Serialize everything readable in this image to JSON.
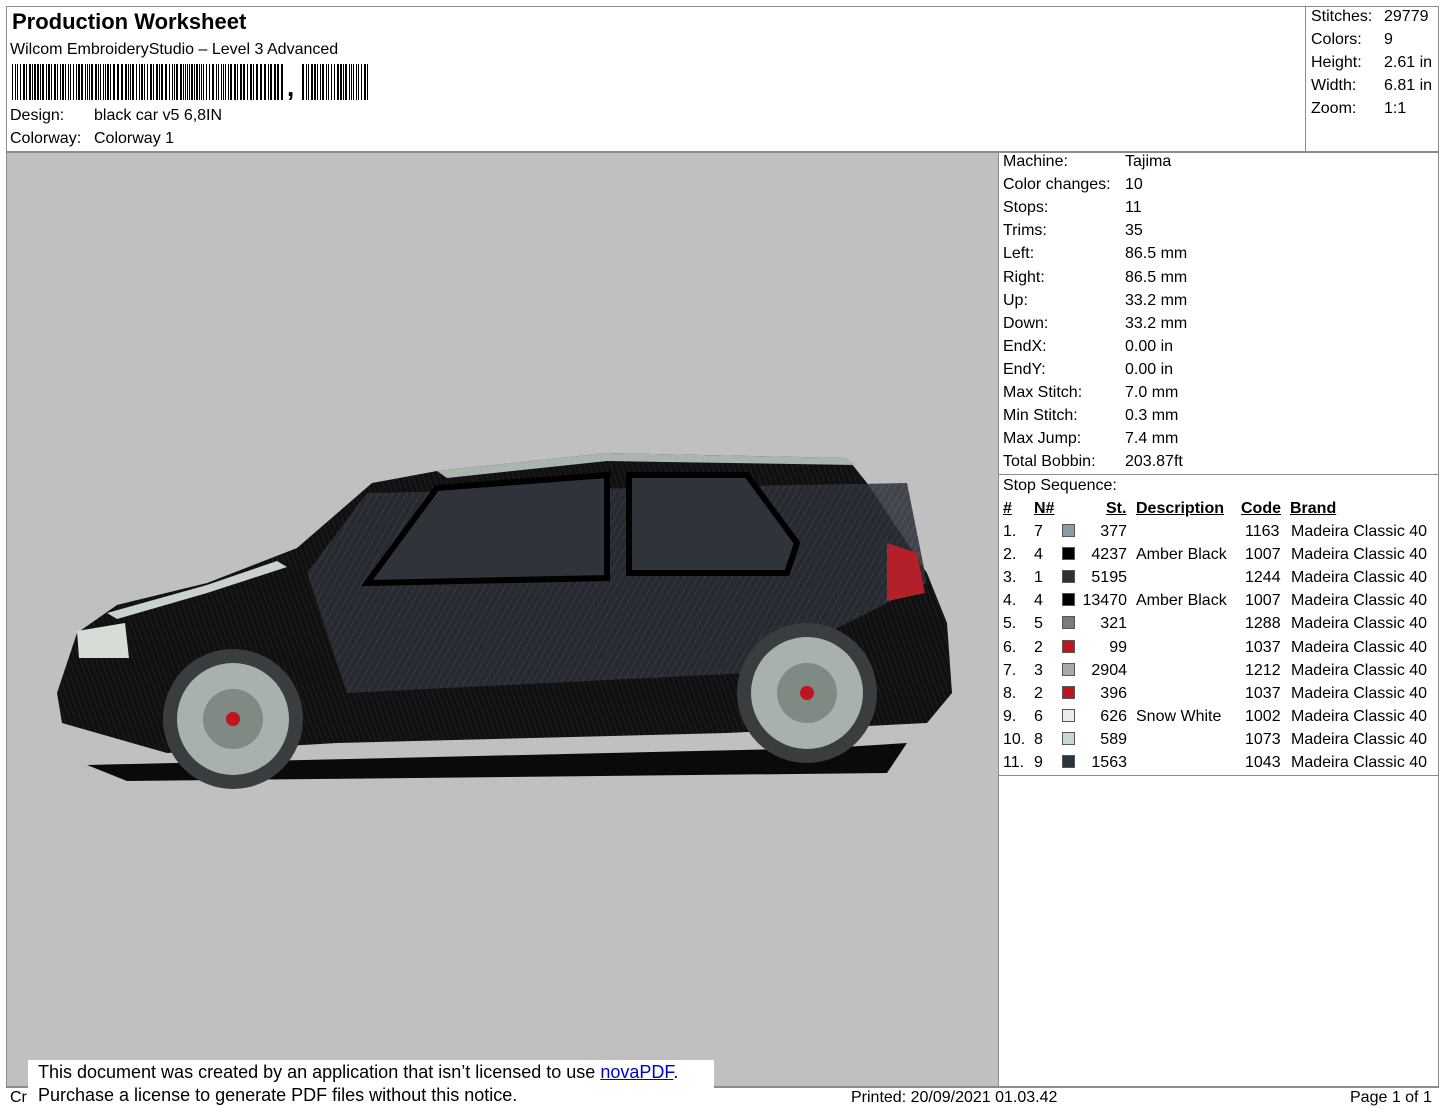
{
  "header": {
    "title": "Production Worksheet",
    "software": "Wilcom EmbroideryStudio – Level 3 Advanced",
    "barcode_suffix": ",",
    "design_label": "Design:",
    "design_value": "black car v5 6,8IN",
    "colorway_label": "Colorway:",
    "colorway_value": "Colorway 1"
  },
  "stats": [
    {
      "k": "Stitches:",
      "v": "29779"
    },
    {
      "k": "Colors:",
      "v": "9"
    },
    {
      "k": "Height:",
      "v": "2.61 in"
    },
    {
      "k": "Width:",
      "v": "6.81 in"
    },
    {
      "k": "Zoom:",
      "v": "1:1"
    }
  ],
  "machine_info": [
    {
      "k": "Machine:",
      "v": "Tajima"
    },
    {
      "k": "Color changes:",
      "v": "10"
    },
    {
      "k": "Stops:",
      "v": "11"
    },
    {
      "k": "Trims:",
      "v": "35"
    },
    {
      "k": "Left:",
      "v": "86.5 mm"
    },
    {
      "k": "Right:",
      "v": "86.5 mm"
    },
    {
      "k": "Up:",
      "v": "33.2 mm"
    },
    {
      "k": "Down:",
      "v": "33.2 mm"
    },
    {
      "k": "EndX:",
      "v": "0.00 in"
    },
    {
      "k": "EndY:",
      "v": "0.00 in"
    },
    {
      "k": "Max Stitch:",
      "v": "7.0 mm"
    },
    {
      "k": "Min Stitch:",
      "v": "0.3 mm"
    },
    {
      "k": "Max Jump:",
      "v": "7.4 mm"
    },
    {
      "k": "Total Bobbin:",
      "v": "203.87ft"
    }
  ],
  "stop_sequence": {
    "title": "Stop Sequence:",
    "headers": {
      "num": "#",
      "n": "N#",
      "st": "St.",
      "desc": "Description",
      "code": "Code",
      "brand": "Brand"
    },
    "rows": [
      {
        "num": "1.",
        "n": "7",
        "color": "#8a9da3",
        "st": "377",
        "desc": "",
        "code": "1163",
        "brand": "Madeira Classic 40"
      },
      {
        "num": "2.",
        "n": "4",
        "color": "#000000",
        "st": "4237",
        "desc": "Amber Black",
        "code": "1007",
        "brand": "Madeira Classic 40"
      },
      {
        "num": "3.",
        "n": "1",
        "color": "#2e2f35",
        "st": "5195",
        "desc": "",
        "code": "1244",
        "brand": "Madeira Classic 40"
      },
      {
        "num": "4.",
        "n": "4",
        "color": "#000000",
        "st": "13470",
        "desc": "Amber Black",
        "code": "1007",
        "brand": "Madeira Classic 40"
      },
      {
        "num": "5.",
        "n": "5",
        "color": "#7a7a78",
        "st": "321",
        "desc": "",
        "code": "1288",
        "brand": "Madeira Classic 40"
      },
      {
        "num": "6.",
        "n": "2",
        "color": "#c0141e",
        "st": "99",
        "desc": "",
        "code": "1037",
        "brand": "Madeira Classic 40"
      },
      {
        "num": "7.",
        "n": "3",
        "color": "#a4a9aa",
        "st": "2904",
        "desc": "",
        "code": "1212",
        "brand": "Madeira Classic 40"
      },
      {
        "num": "8.",
        "n": "2",
        "color": "#c0141e",
        "st": "396",
        "desc": "",
        "code": "1037",
        "brand": "Madeira Classic 40"
      },
      {
        "num": "9.",
        "n": "6",
        "color": "#ebebf3",
        "st": "626",
        "desc": "Snow White",
        "code": "1002",
        "brand": "Madeira Classic 40"
      },
      {
        "num": "10.",
        "n": "8",
        "color": "#c8d9cc",
        "st": "589",
        "desc": "",
        "code": "1073",
        "brand": "Madeira Classic 40"
      },
      {
        "num": "11.",
        "n": "9",
        "color": "#2a3341",
        "st": "1563",
        "desc": "",
        "code": "1043",
        "brand": "Madeira Classic 40"
      }
    ]
  },
  "footer": {
    "left": "Cr",
    "printed": "Printed: 20/09/2021 01.03.42",
    "page": "Page 1 of 1"
  },
  "notice": {
    "line1_prefix": "This document was created by an application that isn’t licensed to use ",
    "link": "novaPDF",
    "line1_suffix": ".",
    "line2": "Purchase a license to generate PDF files without this notice."
  }
}
